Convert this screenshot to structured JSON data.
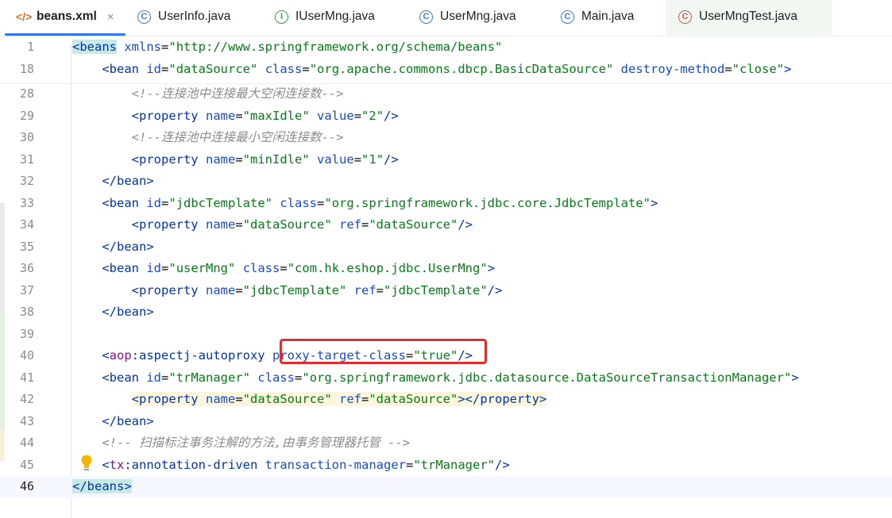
{
  "tabs": [
    {
      "label": "beans.xml",
      "icon": "xml-file-icon",
      "active": true,
      "closable": true
    },
    {
      "label": "UserInfo.java",
      "icon": "java-class-icon"
    },
    {
      "label": "IUserMng.java",
      "icon": "java-interface-icon"
    },
    {
      "label": "UserMng.java",
      "icon": "java-class-icon"
    },
    {
      "label": "Main.java",
      "icon": "java-main-class-icon"
    },
    {
      "label": "UserMngTest.java",
      "icon": "java-test-class-icon"
    }
  ],
  "tab_glyphs": {
    "xml": "</>",
    "class": "C",
    "iface": "I",
    "close": "×"
  },
  "colors": {
    "accent": "#3574f0",
    "tag": "#0033b3",
    "attribute": "#174ad4",
    "string": "#067d17",
    "comment": "#8c8c8c",
    "namespace": "#871094",
    "highlight_box": "#dd3030"
  },
  "current_line": "46",
  "lines": [
    {
      "n": "1",
      "tokens": [
        [
          "tagh",
          "<beans"
        ],
        [
          "sp",
          " "
        ],
        [
          "attr",
          "xmlns"
        ],
        [
          "p",
          "="
        ],
        [
          "val",
          "\"http://www.springframework.org/schema/beans\""
        ]
      ]
    },
    {
      "n": "18",
      "tokens": [
        [
          "sp",
          "    "
        ],
        [
          "tag",
          "<bean"
        ],
        [
          "sp",
          " "
        ],
        [
          "attr",
          "id"
        ],
        [
          "p",
          "="
        ],
        [
          "val",
          "\"dataSource\""
        ],
        [
          "sp",
          " "
        ],
        [
          "attr",
          "class"
        ],
        [
          "p",
          "="
        ],
        [
          "val",
          "\"org.apache.commons.dbcp.BasicDataSource\""
        ],
        [
          "sp",
          " "
        ],
        [
          "attr",
          "destroy-method"
        ],
        [
          "p",
          "="
        ],
        [
          "val",
          "\"close\""
        ],
        [
          "tag",
          ">"
        ]
      ]
    },
    {
      "n": "28",
      "tokens": [
        [
          "sp",
          "        "
        ],
        [
          "cmt",
          "<!--连接池中连接最大空闲连接数-->"
        ]
      ]
    },
    {
      "n": "29",
      "tokens": [
        [
          "sp",
          "        "
        ],
        [
          "tag",
          "<property"
        ],
        [
          "sp",
          " "
        ],
        [
          "attr",
          "name"
        ],
        [
          "p",
          "="
        ],
        [
          "val",
          "\"maxIdle\""
        ],
        [
          "sp",
          " "
        ],
        [
          "attr",
          "value"
        ],
        [
          "p",
          "="
        ],
        [
          "val",
          "\"2\""
        ],
        [
          "tag",
          "/>"
        ]
      ]
    },
    {
      "n": "30",
      "tokens": [
        [
          "sp",
          "        "
        ],
        [
          "cmt",
          "<!--连接池中连接最小空闲连接数-->"
        ]
      ]
    },
    {
      "n": "31",
      "tokens": [
        [
          "sp",
          "        "
        ],
        [
          "tag",
          "<property"
        ],
        [
          "sp",
          " "
        ],
        [
          "attr",
          "name"
        ],
        [
          "p",
          "="
        ],
        [
          "val",
          "\"minIdle\""
        ],
        [
          "sp",
          " "
        ],
        [
          "attr",
          "value"
        ],
        [
          "p",
          "="
        ],
        [
          "val",
          "\"1\""
        ],
        [
          "tag",
          "/>"
        ]
      ]
    },
    {
      "n": "32",
      "tokens": [
        [
          "sp",
          "    "
        ],
        [
          "tag",
          "</bean>"
        ]
      ]
    },
    {
      "n": "33",
      "tokens": [
        [
          "sp",
          "    "
        ],
        [
          "tag",
          "<bean"
        ],
        [
          "sp",
          " "
        ],
        [
          "attr",
          "id"
        ],
        [
          "p",
          "="
        ],
        [
          "val",
          "\"jdbcTemplate\""
        ],
        [
          "sp",
          " "
        ],
        [
          "attr",
          "class"
        ],
        [
          "p",
          "="
        ],
        [
          "val",
          "\"org.springframework.jdbc.core.JdbcTemplate\""
        ],
        [
          "tag",
          ">"
        ]
      ]
    },
    {
      "n": "34",
      "tokens": [
        [
          "sp",
          "        "
        ],
        [
          "tag",
          "<property"
        ],
        [
          "sp",
          " "
        ],
        [
          "attr",
          "name"
        ],
        [
          "p",
          "="
        ],
        [
          "val",
          "\"dataSource\""
        ],
        [
          "sp",
          " "
        ],
        [
          "attr",
          "ref"
        ],
        [
          "p",
          "="
        ],
        [
          "val",
          "\"dataSource\""
        ],
        [
          "tag",
          "/>"
        ]
      ]
    },
    {
      "n": "35",
      "tokens": [
        [
          "sp",
          "    "
        ],
        [
          "tag",
          "</bean>"
        ]
      ]
    },
    {
      "n": "36",
      "tokens": [
        [
          "sp",
          "    "
        ],
        [
          "tag",
          "<bean"
        ],
        [
          "sp",
          " "
        ],
        [
          "attr",
          "id"
        ],
        [
          "p",
          "="
        ],
        [
          "val",
          "\"userMng\""
        ],
        [
          "sp",
          " "
        ],
        [
          "attr",
          "class"
        ],
        [
          "p",
          "="
        ],
        [
          "val",
          "\"com.hk.eshop.jdbc.UserMng\""
        ],
        [
          "tag",
          ">"
        ]
      ]
    },
    {
      "n": "37",
      "tokens": [
        [
          "sp",
          "        "
        ],
        [
          "tag",
          "<property"
        ],
        [
          "sp",
          " "
        ],
        [
          "attr",
          "name"
        ],
        [
          "p",
          "="
        ],
        [
          "val",
          "\"jdbcTemplate\""
        ],
        [
          "sp",
          " "
        ],
        [
          "attr",
          "ref"
        ],
        [
          "p",
          "="
        ],
        [
          "val",
          "\"jdbcTemplate\""
        ],
        [
          "tag",
          "/>"
        ]
      ]
    },
    {
      "n": "38",
      "tokens": [
        [
          "sp",
          "    "
        ],
        [
          "tag",
          "</bean>"
        ]
      ]
    },
    {
      "n": "39",
      "tokens": []
    },
    {
      "n": "40",
      "tokens": [
        [
          "sp",
          "    "
        ],
        [
          "tag",
          "<"
        ],
        [
          "ns",
          "aop"
        ],
        [
          "tag",
          ":aspectj-autoproxy"
        ],
        [
          "sp",
          " "
        ],
        [
          "attr",
          "proxy-target-class"
        ],
        [
          "p",
          "="
        ],
        [
          "val",
          "\"true\""
        ],
        [
          "tag",
          "/>"
        ]
      ]
    },
    {
      "n": "41",
      "tokens": [
        [
          "sp",
          "    "
        ],
        [
          "tag",
          "<bean"
        ],
        [
          "sp",
          " "
        ],
        [
          "attr",
          "id"
        ],
        [
          "p",
          "="
        ],
        [
          "val",
          "\"trManager\""
        ],
        [
          "sp",
          " "
        ],
        [
          "attr",
          "class"
        ],
        [
          "p",
          "="
        ],
        [
          "val",
          "\"org.springframework.jdbc.datasource.DataSourceTransactionManager\""
        ],
        [
          "tag",
          ">"
        ]
      ]
    },
    {
      "n": "42",
      "hl": true,
      "tokens": [
        [
          "sp",
          "        "
        ],
        [
          "tag",
          "<property"
        ],
        [
          "sp",
          " "
        ],
        [
          "attr",
          "name"
        ],
        [
          "p",
          "="
        ],
        [
          "val",
          "\"dataSource\""
        ],
        [
          "sp",
          " "
        ],
        [
          "attr",
          "ref"
        ],
        [
          "p",
          "="
        ],
        [
          "val",
          "\"dataSource\""
        ],
        [
          "tag",
          "></property>"
        ]
      ]
    },
    {
      "n": "43",
      "tokens": [
        [
          "sp",
          "    "
        ],
        [
          "tag",
          "</bean>"
        ]
      ]
    },
    {
      "n": "44",
      "tokens": [
        [
          "sp",
          "    "
        ],
        [
          "cmt",
          "<!-- 扫描标注事务注解的方法,由事务管理器托管 -->"
        ]
      ]
    },
    {
      "n": "45",
      "tokens": [
        [
          "sp",
          "    "
        ],
        [
          "tag",
          "<"
        ],
        [
          "ns",
          "tx"
        ],
        [
          "tag",
          ":annotation-driven"
        ],
        [
          "sp",
          " "
        ],
        [
          "attr",
          "transaction-manager"
        ],
        [
          "p",
          "="
        ],
        [
          "val",
          "\"trManager\""
        ],
        [
          "tag",
          "/>"
        ]
      ]
    },
    {
      "n": "46",
      "tokens": [
        [
          "tagh",
          "</beans>"
        ]
      ]
    }
  ]
}
